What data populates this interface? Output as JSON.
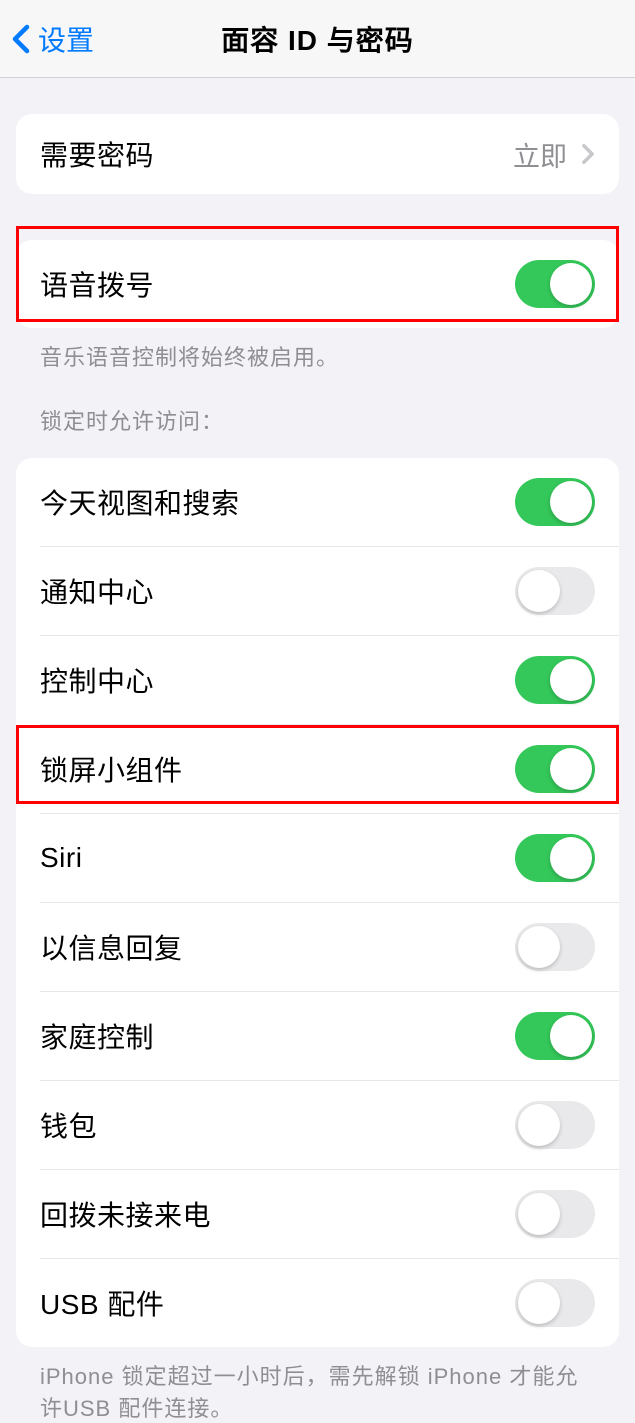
{
  "nav": {
    "back_label": "设置",
    "title": "面容 ID 与密码"
  },
  "group1": {
    "require_passcode": {
      "label": "需要密码",
      "value": "立即"
    }
  },
  "group2": {
    "voice_dial": {
      "label": "语音拨号",
      "on": true
    },
    "footer": "音乐语音控制将始终被启用。"
  },
  "group3": {
    "header": "锁定时允许访问：",
    "items": [
      {
        "label": "今天视图和搜索",
        "on": true
      },
      {
        "label": "通知中心",
        "on": false
      },
      {
        "label": "控制中心",
        "on": true
      },
      {
        "label": "锁屏小组件",
        "on": true
      },
      {
        "label": "Siri",
        "on": true
      },
      {
        "label": "以信息回复",
        "on": false
      },
      {
        "label": "家庭控制",
        "on": true
      },
      {
        "label": "钱包",
        "on": false
      },
      {
        "label": "回拨未接来电",
        "on": false
      },
      {
        "label": "USB 配件",
        "on": false
      }
    ],
    "footer": "iPhone 锁定超过一小时后，需先解锁 iPhone 才能允许USB 配件连接。"
  }
}
